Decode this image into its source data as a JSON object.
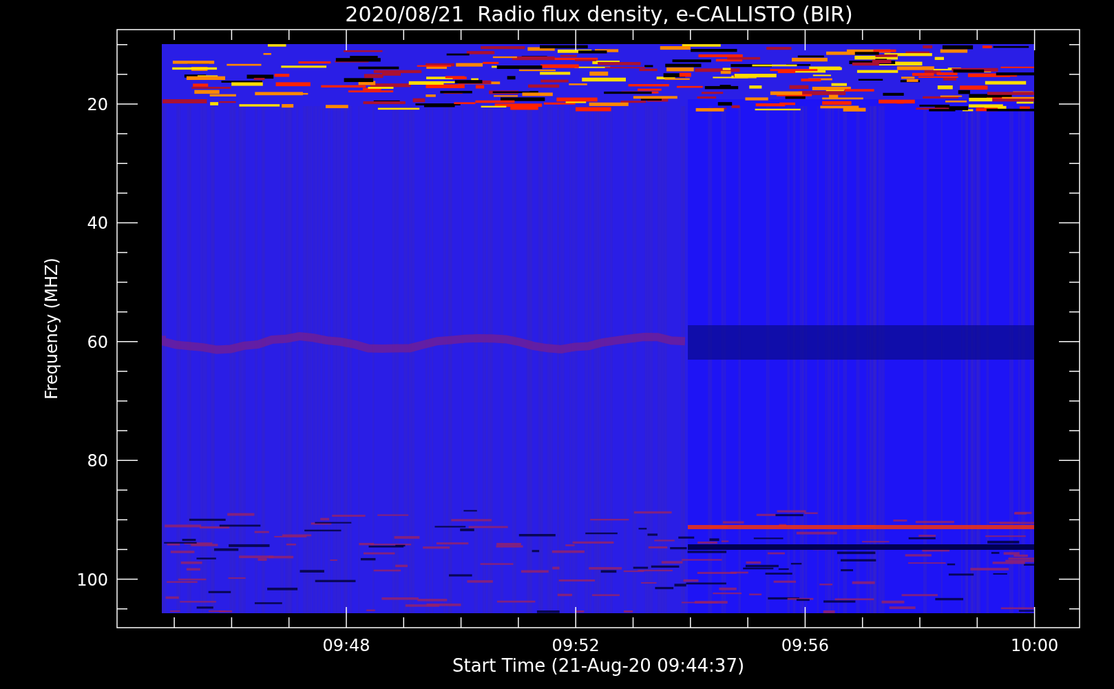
{
  "plot": {
    "title": "2020/08/21  Radio flux density, e-CALLISTO (BIR)",
    "y_axis": {
      "label": "Frequency (MHZ)",
      "ticks": [
        "20",
        "40",
        "60",
        "80",
        "100"
      ]
    },
    "x_axis": {
      "label": "Start Time (21-Aug-20 09:44:37)",
      "ticks": [
        "09:48",
        "09:52",
        "09:56",
        "10:00"
      ]
    }
  }
}
